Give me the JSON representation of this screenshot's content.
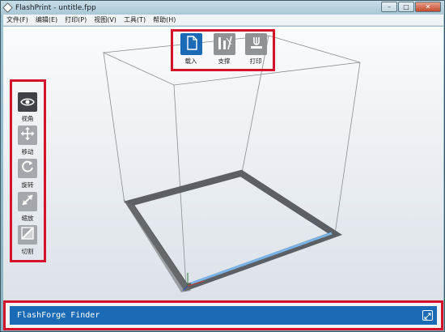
{
  "window": {
    "title": "FlashPrint - untitle.fpp",
    "minimize_glyph": "–",
    "maximize_glyph": "□",
    "close_glyph": "✕"
  },
  "menu": {
    "items": [
      {
        "label": "文件(F)"
      },
      {
        "label": "编辑(E)"
      },
      {
        "label": "打印(P)"
      },
      {
        "label": "视图(V)"
      },
      {
        "label": "工具(T)"
      },
      {
        "label": "帮助(H)"
      }
    ]
  },
  "top_toolbar": {
    "load_label": "载入",
    "support_label": "支撑",
    "print_label": "打印"
  },
  "left_toolbar": {
    "view_label": "视角",
    "move_label": "移动",
    "rotate_label": "旋转",
    "scale_label": "缩放",
    "cut_label": "切割"
  },
  "status": {
    "text": "FlashForge Finder"
  },
  "colors": {
    "accent": "#1a6ab5",
    "highlight_border": "#d4122a",
    "tool_active": "#3f4347",
    "tool_inactive": "#a4a8ac"
  }
}
